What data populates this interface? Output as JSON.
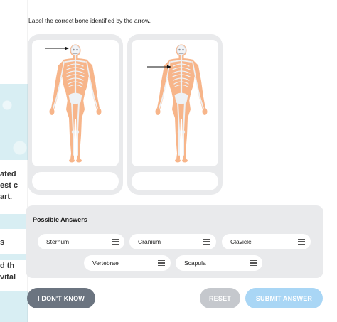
{
  "background_page": {
    "lines_1": [
      "ated",
      "est c",
      "art."
    ],
    "line_2": "s",
    "lines_3": [
      "d th",
      "vital"
    ]
  },
  "question": {
    "prompt": "Label the correct bone identified by the arrow."
  },
  "cards": [
    {
      "arrow_target": "skull",
      "answer": ""
    },
    {
      "arrow_target": "chest",
      "answer": ""
    }
  ],
  "answers": {
    "title": "Possible Answers",
    "options": [
      "Sternum",
      "Cranium",
      "Clavicle",
      "Vertebrae",
      "Scapula"
    ]
  },
  "buttons": {
    "dont_know": "I DON'T KNOW",
    "reset": "RESET",
    "submit": "SUBMIT ANSWER"
  },
  "colors": {
    "body_orange": "#f7b58a",
    "bone_white": "#eef2f6",
    "card_gray": "#e9eaec",
    "dont_know_button": "#6b7480",
    "reset_button": "#c5c8cd",
    "submit_button": "#a9d6f5"
  }
}
